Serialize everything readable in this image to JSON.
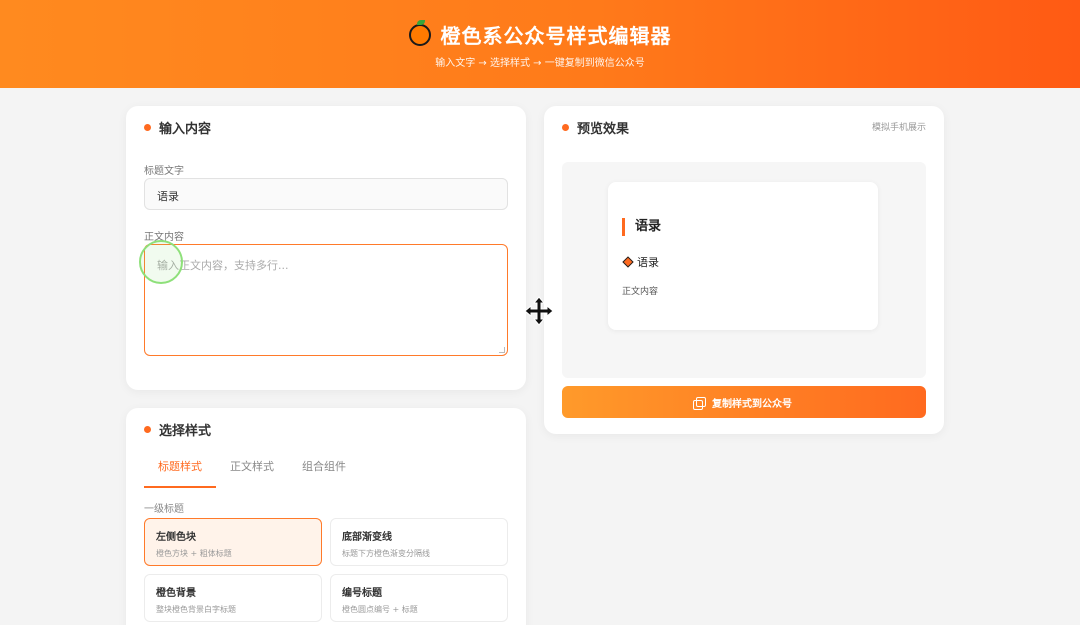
{
  "header": {
    "title": "橙色系公众号样式编辑器",
    "subtitle": "输入文字 → 选择样式 → 一键复制到微信公众号"
  },
  "input_card": {
    "title": "输入内容",
    "title_label": "标题文字",
    "title_value": "语录",
    "body_label": "正文内容",
    "body_placeholder": "输入正文内容，支持多行..."
  },
  "style_card": {
    "title": "选择样式",
    "tabs": [
      {
        "label": "标题样式",
        "active": true
      },
      {
        "label": "正文样式",
        "active": false
      },
      {
        "label": "组合组件",
        "active": false
      }
    ],
    "section_label": "一级标题",
    "items": [
      {
        "name": "左侧色块",
        "desc": "橙色方块 + 粗体标题",
        "selected": true
      },
      {
        "name": "底部渐变线",
        "desc": "标题下方橙色渐变分隔线",
        "selected": false
      },
      {
        "name": "橙色背景",
        "desc": "整块橙色背景白字标题",
        "selected": false
      },
      {
        "name": "编号标题",
        "desc": "橙色圆点编号 + 标题",
        "selected": false
      }
    ]
  },
  "preview_card": {
    "title": "预览效果",
    "hint": "模拟手机展示",
    "h1": "语录",
    "h2": "语录",
    "body": "正文内容",
    "copy_button": "复制样式到公众号"
  },
  "colors": {
    "accent": "#ff6a1f",
    "header_start": "#ff8a1f",
    "header_end": "#ff5a14"
  }
}
